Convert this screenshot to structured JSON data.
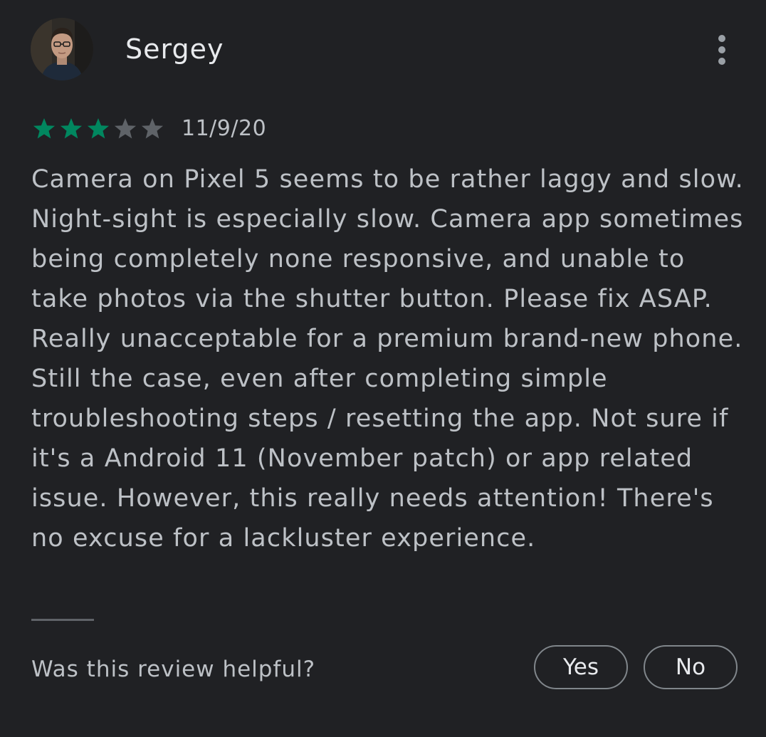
{
  "review": {
    "author": "Sergey",
    "rating": 3,
    "max_rating": 5,
    "date": "11/9/20",
    "text": "Camera on Pixel 5 seems to be rather laggy and slow. Night-sight is especially slow. Camera app sometimes being completely none responsive, and unable to take photos via the shutter button. Please fix ASAP. Really unacceptable for a premium brand-new phone. Still the case, even after completing simple troubleshooting steps / resetting the app. Not sure if it's a Android 11 (November patch) or app related issue. However, this really needs attention! There's no excuse for a lackluster experience."
  },
  "helpful": {
    "question": "Was this review helpful?",
    "yes_label": "Yes",
    "no_label": "No"
  },
  "colors": {
    "background": "#202124",
    "star_filled": "#01875f",
    "star_empty": "#5f6368",
    "text_primary": "#e8eaed",
    "text_secondary": "#bdc1c6"
  },
  "icons": {
    "more": "more-vert-icon",
    "star": "star-icon"
  }
}
